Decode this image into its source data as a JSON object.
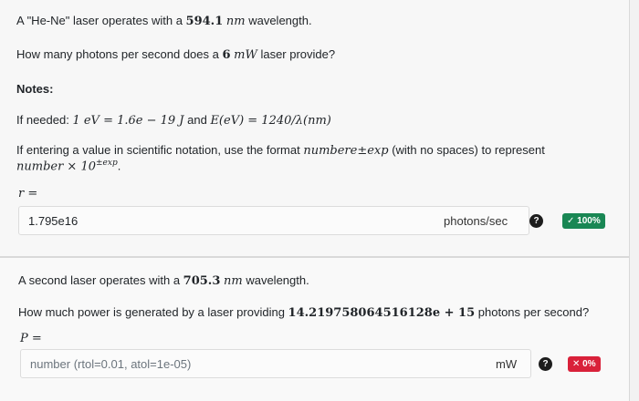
{
  "q1": {
    "intro_pre": "A \"He-Ne\" laser operates with a ",
    "intro_value": "594.1",
    "intro_unit": "nm",
    "intro_post": " wavelength.",
    "question_pre": "How many photons per second does a ",
    "question_value": "6",
    "question_unit": "mW",
    "question_post": " laser provide?",
    "notes_heading": "Notes:",
    "if_needed": "If needed: ",
    "eq1": "1 eV = 1.6e − 19 J",
    "and": " and ",
    "eq2": "E(eV) = 1240/λ(nm)",
    "sci_line1_pre": "If entering a value in scientific notation, use the format ",
    "sci_format": "numbere±exp",
    "sci_line1_post": " (with no spaces) to represent",
    "sci_line2": "number × 10",
    "sci_exp": "±exp",
    "sci_dot": ".",
    "var_label": "r =",
    "answer_value": "1.795e16",
    "answer_unit": "photons/sec",
    "help_glyph": "?",
    "status": "✓ 100%",
    "status_color": "#198754"
  },
  "q2": {
    "intro_pre": "A second laser operates with a ",
    "intro_value": "705.3",
    "intro_unit": "nm",
    "intro_post": " wavelength.",
    "question_pre": "How much power is generated by a laser providing ",
    "question_value": "14.219758064516128e + 15",
    "question_post": " photons per second?",
    "var_label": "P =",
    "placeholder": "number (rtol=0.01, atol=1e-05)",
    "answer_unit": "mW",
    "help_glyph": "?",
    "status": "✕ 0%",
    "status_color": "#d9213a"
  }
}
